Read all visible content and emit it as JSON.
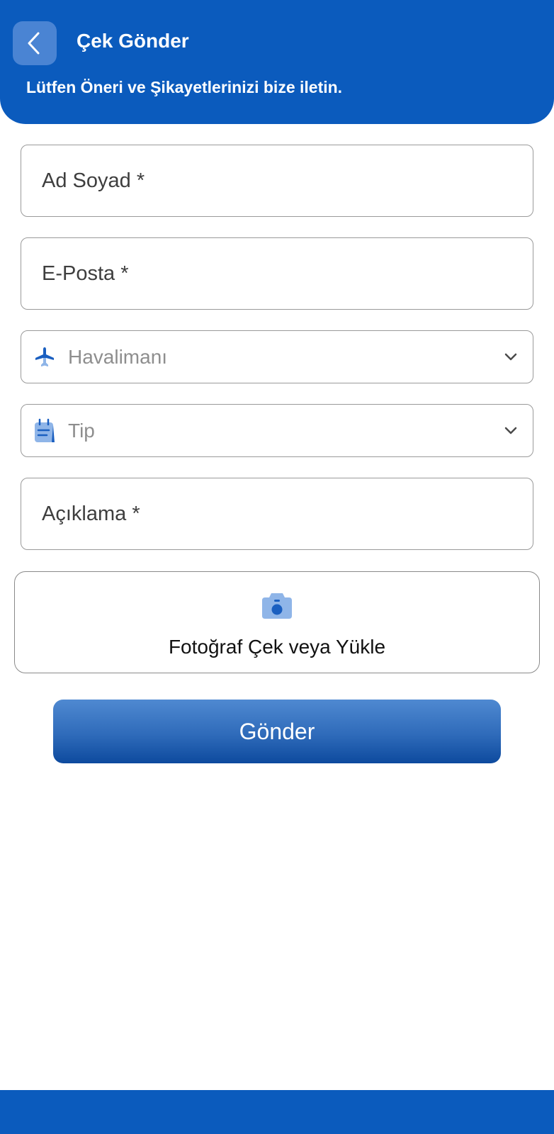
{
  "header": {
    "title": "Çek Gönder",
    "subtitle": "Lütfen Öneri ve Şikayetlerinizi bize iletin.",
    "back_icon": "chevron-left-icon",
    "background_color": "#0b5bbd"
  },
  "form": {
    "full_name": {
      "placeholder": "Ad Soyad *"
    },
    "email": {
      "placeholder": "E-Posta *"
    },
    "airport": {
      "placeholder": "Havalimanı",
      "icon": "airplane-icon"
    },
    "type": {
      "placeholder": "Tip",
      "icon": "notepad-icon"
    },
    "description": {
      "placeholder": "Açıklama *"
    },
    "photo": {
      "label": "Fotoğraf Çek veya Yükle",
      "icon": "camera-icon"
    },
    "submit_label": "Gönder"
  },
  "colors": {
    "primary": "#0b5bbd",
    "icon_light": "#8fb5e8",
    "icon_dark": "#1a5fc0"
  }
}
